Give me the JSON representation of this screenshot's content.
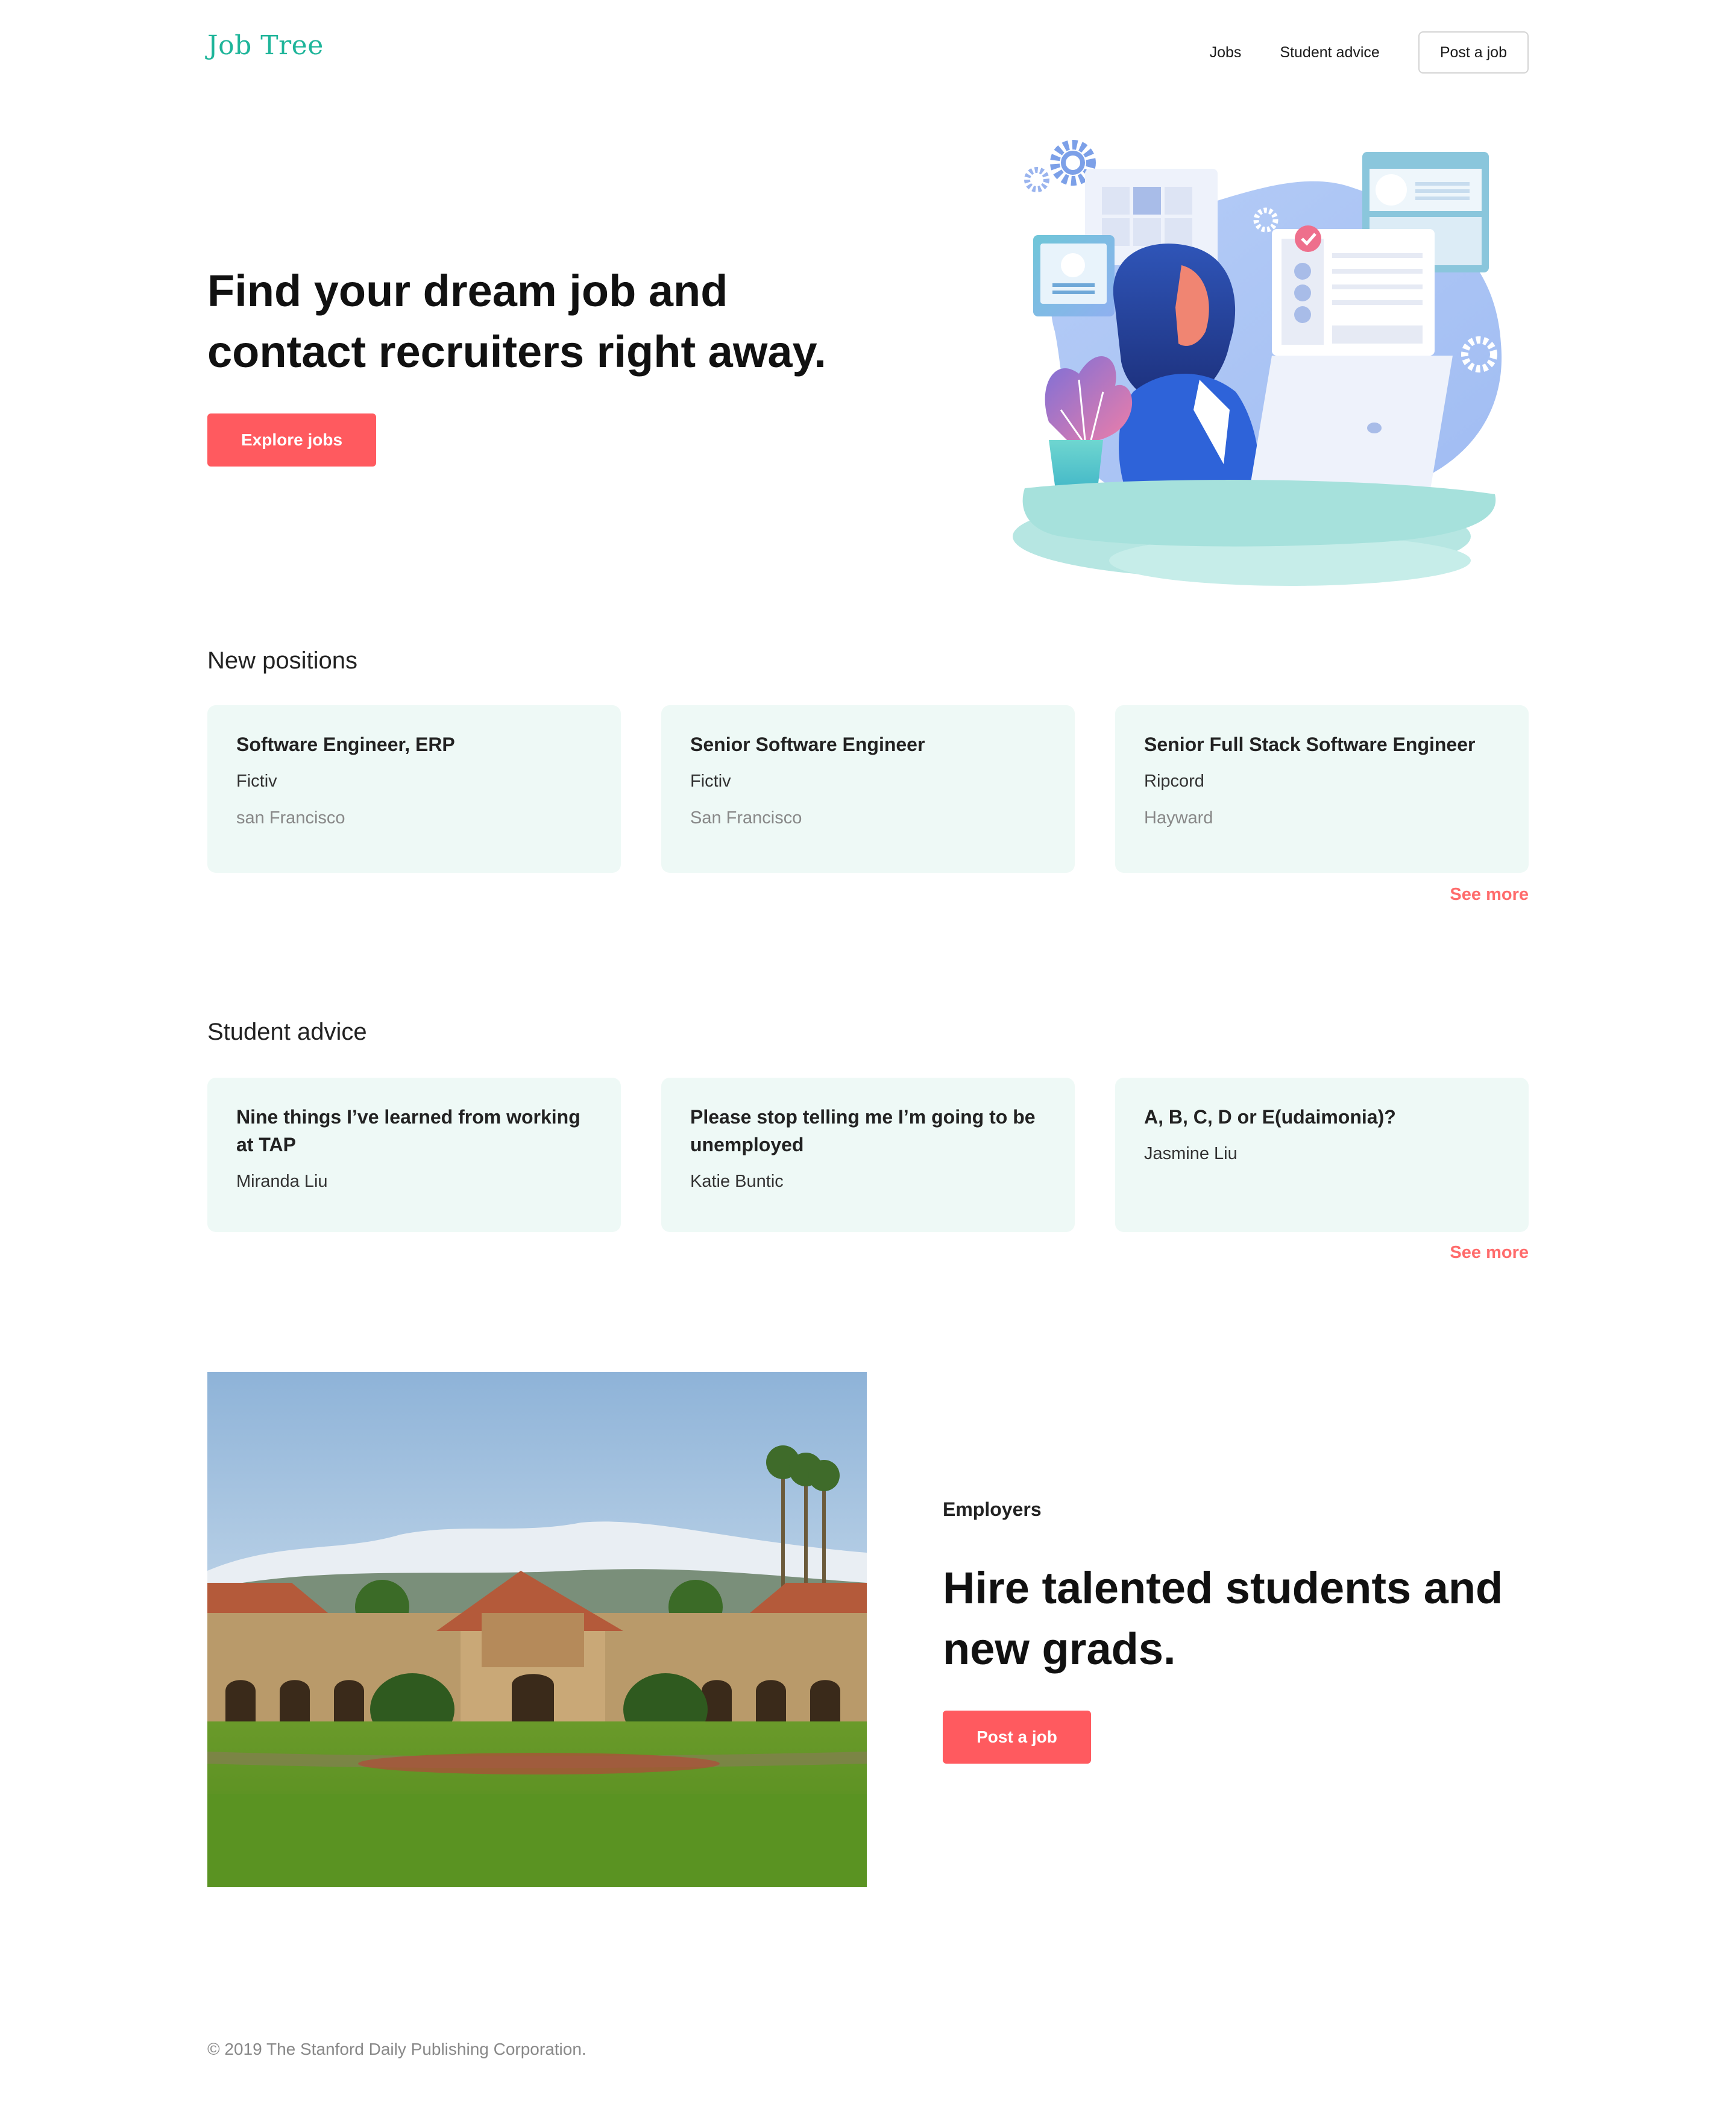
{
  "header": {
    "logo": "Job Tree",
    "nav": {
      "jobs": "Jobs",
      "advice": "Student advice",
      "post": "Post a job"
    }
  },
  "hero": {
    "title": "Find your dream job and contact recruiters right away.",
    "button": "Explore jobs"
  },
  "positions": {
    "title": "New positions",
    "items": [
      {
        "title": "Software Engineer, ERP",
        "company": "Fictiv",
        "location": "san Francisco"
      },
      {
        "title": "Senior Software Engineer",
        "company": "Fictiv",
        "location": "San Francisco"
      },
      {
        "title": "Senior Full Stack Software Engineer",
        "company": "Ripcord",
        "location": "Hayward"
      }
    ],
    "see_more": "See more"
  },
  "advice": {
    "title": "Student advice",
    "items": [
      {
        "title": "Nine things I’ve learned from working at TAP",
        "author": "Miranda Liu"
      },
      {
        "title": "Please stop telling me I’m going to be unemployed",
        "author": "Katie Buntic"
      },
      {
        "title": "A, B, C, D or E(udaimonia)?",
        "author": "Jasmine Liu"
      }
    ],
    "see_more": "See more"
  },
  "employers": {
    "label": "Employers",
    "title": "Hire talented students and new grads.",
    "button": "Post a job"
  },
  "footer": {
    "copyright": "© 2019 The Stanford Daily Publishing Corporation."
  },
  "colors": {
    "accent": "#ff5a5f",
    "brand": "#1fb59a",
    "card_bg": "#eef9f6",
    "link": "#ff6b6b"
  }
}
